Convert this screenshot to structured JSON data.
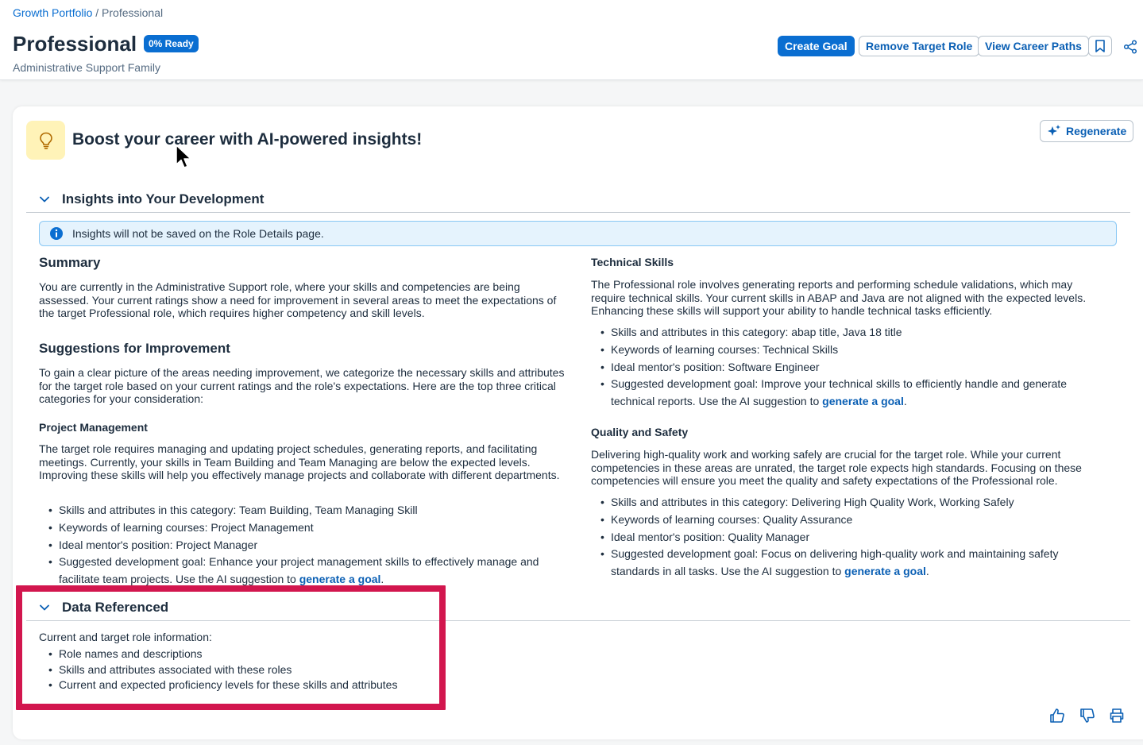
{
  "breadcrumb": {
    "root": "Growth Portfolio",
    "separator": " / ",
    "current": "Professional"
  },
  "header": {
    "title": "Professional",
    "ready_badge": "0% Ready",
    "subtitle": "Administrative Support Family",
    "buttons": {
      "create_goal": "Create Goal",
      "remove_target_role": "Remove Target Role",
      "view_career_paths": "View Career Paths"
    }
  },
  "card": {
    "title": "Boost your career with AI-powered insights!",
    "regenerate_label": "Regenerate"
  },
  "insights_section": {
    "label": "Insights into Your Development",
    "info_message": "Insights will not be saved on the Role Details page."
  },
  "summary": {
    "heading": "Summary",
    "text": "You are currently in the Administrative Support role, where your skills and competencies are being assessed. Your current ratings show a need for improvement in several areas to meet the expectations of the target Professional role, which requires higher competency and skill levels."
  },
  "suggestions": {
    "heading": "Suggestions for Improvement",
    "text": "To gain a clear picture of the areas needing improvement, we categorize the necessary skills and attributes for the target role based on your current ratings and the role's expectations. Here are the top three critical categories for your consideration:"
  },
  "project_management": {
    "heading": "Project Management",
    "text": "The target role requires managing and updating project schedules, generating reports, and facilitating meetings. Currently, your skills in Team Building and Team Managing are below the expected levels. Improving these skills will help you effectively manage projects and collaborate with different departments.",
    "bullets": [
      "Skills and attributes in this category: Team Building, Team Managing Skill",
      "Keywords of learning courses: Project Management",
      "Ideal mentor's position: Project Manager"
    ],
    "goal_text": "Suggested development goal: Enhance your project management skills to effectively manage and facilitate team projects. Use the AI suggestion to ",
    "goal_link": "generate a goal",
    "goal_end": "."
  },
  "technical_skills": {
    "heading": "Technical Skills",
    "text": "The Professional role involves generating reports and performing schedule validations, which may require technical skills. Your current skills in ABAP and Java are not aligned with the expected levels. Enhancing these skills will support your ability to handle technical tasks efficiently.",
    "bullets": [
      "Skills and attributes in this category: abap title, Java 18 title",
      "Keywords of learning courses: Technical Skills",
      "Ideal mentor's position: Software Engineer"
    ],
    "goal_text": "Suggested development goal: Improve your technical skills to efficiently handle and generate technical reports. Use the AI suggestion to ",
    "goal_link": "generate a goal",
    "goal_end": "."
  },
  "quality_safety": {
    "heading": "Quality and Safety",
    "text": "Delivering high-quality work and working safely are crucial for the target role. While your current competencies in these areas are unrated, the target role expects high standards. Focusing on these competencies will ensure you meet the quality and safety expectations of the Professional role.",
    "bullets": [
      "Skills and attributes in this category: Delivering High Quality Work, Working Safely",
      "Keywords of learning courses: Quality Assurance",
      "Ideal mentor's position: Quality Manager"
    ],
    "goal_text": "Suggested development goal: Focus on delivering high-quality work and maintaining safety standards in all tasks. Use the AI suggestion to ",
    "goal_link": "generate a goal",
    "goal_end": "."
  },
  "data_referenced": {
    "label": "Data Referenced",
    "intro": "Current and target role information:",
    "bullets": [
      "Role names and descriptions",
      "Skills and attributes associated with these roles",
      "Current and expected proficiency levels for these skills and attributes"
    ]
  },
  "colors": {
    "accent": "#0a6ed1",
    "highlight_box": "#d2164e",
    "bulb_bg": "#fff3b8",
    "info_bg": "#e5f3fd"
  }
}
